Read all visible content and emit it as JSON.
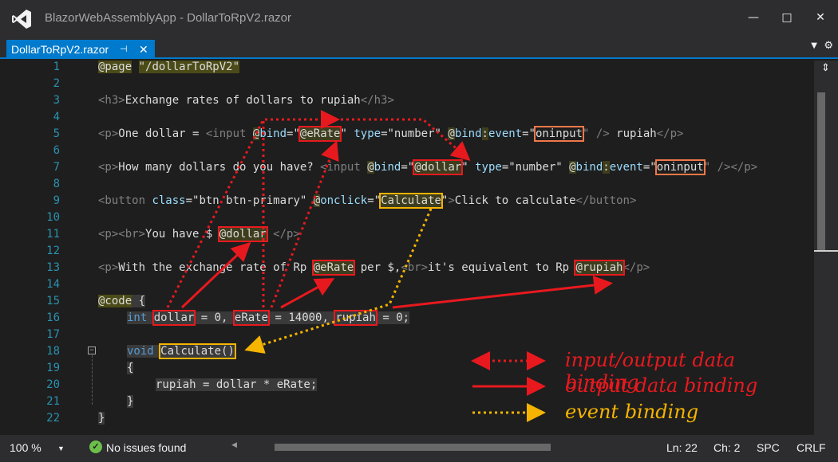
{
  "window": {
    "title": "BlazorWebAssemblyApp - DollarToRpV2.razor",
    "minimize": "—",
    "maximize": "□",
    "close": "✕"
  },
  "tabs": [
    {
      "label": "DollarToRpV2.razor",
      "pin": "⊣",
      "close": "✕"
    }
  ],
  "tab_strip": {
    "dropdown": "▼",
    "settings": "⚙"
  },
  "editor": {
    "line_numbers": [
      "1",
      "2",
      "3",
      "4",
      "5",
      "6",
      "7",
      "8",
      "9",
      "10",
      "11",
      "12",
      "13",
      "14",
      "15",
      "16",
      "17",
      "18",
      "19",
      "20",
      "21",
      "22"
    ],
    "fold_symbol": "−",
    "line1": {
      "directive": "@page",
      "route": "\"/dollarToRpV2\""
    },
    "line3": {
      "open": "<h3>",
      "text": "Exchange rates of dollars to rupiah",
      "close": "</h3>"
    },
    "line5": {
      "p": "<p>",
      "text1": "One dollar = ",
      "input": "<input",
      "bind_at": "@",
      "bind": "bind",
      "eq1": "=\"",
      "erate": "@eRate",
      "q1": "\"",
      "type_attr": " type",
      "type_val": "=\"number\" ",
      "bind2_at": "@",
      "bind2": "bind",
      "colon": ":",
      "event": "event",
      "eq2": "=\"",
      "oninput": "oninput",
      "end": "\" />",
      "rupiah": " rupiah",
      "close": "</p>"
    },
    "line7": {
      "p": "<p>",
      "text1": "How many dollars do you have? ",
      "input": "<input",
      "bind_at": "@",
      "bind": "bind",
      "eq1": "=\"",
      "dollar": "@dollar",
      "q1": "\"",
      "type_attr": " type",
      "type_val": "=\"number\" ",
      "bind2_at": "@",
      "bind2": "bind",
      "colon": ":",
      "event": "event",
      "eq2": "=\"",
      "oninput": "oninput",
      "end": "\" />",
      "close": "</p>"
    },
    "line9": {
      "open": "<button",
      "class_attr": " class",
      "class_val": "=\"btn btn-primary\" ",
      "onclick_at": "@",
      "onclick": "onclick",
      "eq": "=\"",
      "calc": "Calculate",
      "q": "\"",
      "gt": ">",
      "text": "Click to calculate",
      "close": "</button>"
    },
    "line11": {
      "p": "<p>",
      "br": "<br>",
      "text": "You have $ ",
      "dollar": "@dollar",
      "close": " </p>"
    },
    "line13": {
      "p": "<p>",
      "text1": "With the exchange rate of Rp ",
      "erate": "@eRate",
      "text2": " per $,",
      "br": "<br>",
      "text3": "it's equivalent to Rp ",
      "rupiah": "@rupiah",
      "close": "</p>"
    },
    "line15": {
      "code": "@code",
      "brace": " {"
    },
    "line16": {
      "int": "int",
      "dollar": "dollar",
      "eq1": " = 0, ",
      "erate": "eRate",
      "eq2": " = 14000, ",
      "rupiah": "rupiah",
      "eq3": " = 0;"
    },
    "line18": {
      "void": "void",
      "calc": "Calculate()"
    },
    "line19": {
      "text": "{"
    },
    "line20": {
      "text": "rupiah = dollar * eRate;"
    },
    "line21": {
      "text": "}"
    },
    "line22": {
      "text": "}"
    }
  },
  "legend": [
    {
      "label": "input/output data binding",
      "color": "#e8191e",
      "style": "dotted"
    },
    {
      "label": "output data binding",
      "color": "#e8191e",
      "style": "solid"
    },
    {
      "label": "event binding",
      "color": "#f5b400",
      "style": "dotted"
    }
  ],
  "scrollbar": {
    "split_icon": "⇕"
  },
  "statusbar": {
    "zoom": "100 %",
    "zoom_dropdown": "▼",
    "issues_icon": "✓",
    "issues": "No issues found",
    "ln": "Ln: 22",
    "ch": "Ch: 2",
    "spc": "SPC",
    "crlf": "CRLF"
  }
}
